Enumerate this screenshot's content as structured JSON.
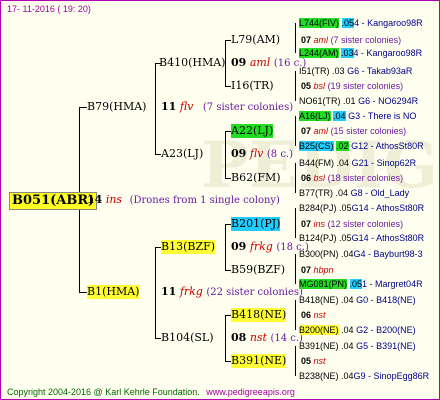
{
  "header": {
    "date": "17- 11-2016 ( 19: 20)"
  },
  "watermark": "PEDIGREE",
  "root": "B051(ABR)",
  "root_gen": {
    "num": "14",
    "code": "ins",
    "note": "(Drones from 1 single colony)"
  },
  "lvl1": [
    {
      "label": "B79(HMA)",
      "num": "11",
      "code": "flv",
      "note": "(7 sister colonies)"
    },
    {
      "label": "B1(HMA)",
      "num": "11",
      "code": "frkg",
      "note": "(22 sister colonies)"
    }
  ],
  "lvl2": [
    {
      "label": "B410(HMA)",
      "num": "09",
      "code": "aml",
      "note": "(16 c.)"
    },
    {
      "label": "A23(LJ)",
      "num": "09",
      "code": "flv",
      "note": "(8 c.)"
    },
    {
      "label": "B13(BZF)",
      "num": "09",
      "code": "frkg",
      "note": "(18 c.)"
    },
    {
      "label": "B104(SL)",
      "num": "08",
      "code": "nst",
      "note": "(14 c.)"
    }
  ],
  "lvl3": [
    {
      "label": "L79(AM)",
      "num": "07",
      "code": "aml",
      "note": "(7 sister colonies)"
    },
    {
      "label": "I16(TR)",
      "num": "05",
      "code": "bsl",
      "note": "(19 sister colonies)"
    },
    {
      "label": "A22(LJ)",
      "num": "07",
      "code": "aml",
      "note": "(15 sister colonies)"
    },
    {
      "label": "B62(FM)",
      "num": "06",
      "code": "bsl",
      "note": "(18 sister colonies)"
    },
    {
      "label": "B201(PJ)",
      "num": "07",
      "code": "ins",
      "note": "(12 sister colonies)"
    },
    {
      "label": "B59(BZF)",
      "num": "07",
      "code": "hbpn",
      "note": ""
    },
    {
      "label": "B418(NE)",
      "num": "06",
      "code": "nst",
      "note": ""
    },
    {
      "label": "B391(NE)",
      "num": "05",
      "code": "nst",
      "note": ""
    }
  ],
  "lvl4": [
    {
      "label": "L744(FIV)",
      "num": ".05",
      "gen": "4 - Kangaroo98R"
    },
    {
      "label": "L244(AM)",
      "num": ".03",
      "gen": "4 - Kangaroo98R"
    },
    {
      "label": "I51(TR)",
      "num": ".03",
      "gen": "G6 - Takab93aR"
    },
    {
      "label": "NO61(TR)",
      "num": ".01",
      "gen": "G6 - NO6294R"
    },
    {
      "label": "A16(LJ)",
      "num": ".04",
      "gen": "G3 - There is NO"
    },
    {
      "label": "B25(CS)",
      "num": ".02",
      "gen": "G12 - AthosSt80R"
    },
    {
      "label": "B44(FM)",
      "num": ".04",
      "gen": "G21 - Sinop62R"
    },
    {
      "label": "B77(TR)",
      "num": ".04",
      "gen": "G8 - Old_Lady"
    },
    {
      "label": "B284(PJ)",
      "num": ".05",
      "gen": "G14 - AthosSt80R"
    },
    {
      "label": "B124(PJ)",
      "num": ".05",
      "gen": "G14 - AthosSt80R"
    },
    {
      "label": "B300(PN)",
      "num": ".04",
      "gen": "G4 - Bayburt98-3"
    },
    {
      "label": "MG081(PN)",
      "num": ".05",
      "gen": "1 - Margret04R"
    },
    {
      "label": "B418(NE)",
      "num": ".04",
      "gen": "G0 - B418(NE)"
    },
    {
      "label": "B200(NE)",
      "num": ".04",
      "gen": "G2 - B200(NE)"
    },
    {
      "label": "B391(NE)",
      "num": ".04",
      "gen": "G5 - B391(NE)"
    },
    {
      "label": "B238(NE)",
      "num": ".04",
      "gen": "G9 - SinopEgg86R"
    }
  ],
  "footer": {
    "copyright": "Copyright 2004-2016 @ Karl Kehrle Foundation.",
    "url": "www.pedigreeapis.org"
  }
}
